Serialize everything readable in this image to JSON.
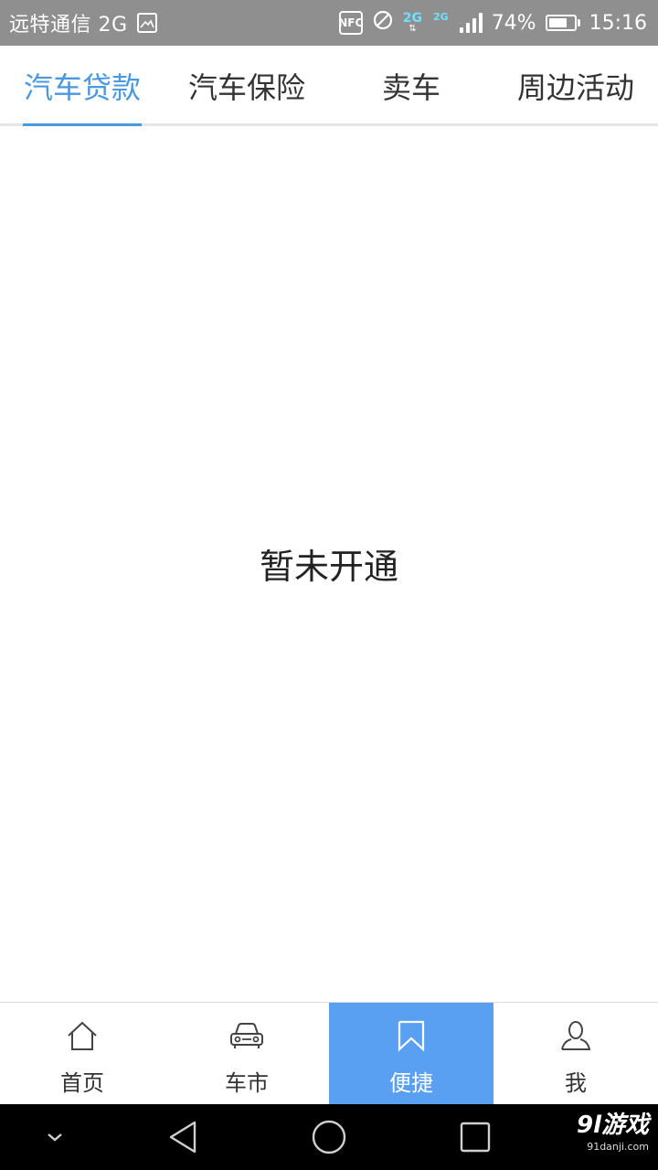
{
  "statusbar": {
    "carrier": "远特通信 2G",
    "nfc": "NFC",
    "network_primary": "2G",
    "network_secondary": "2G",
    "battery_percent_text": "74%",
    "battery_level": 0.74,
    "time": "15:16"
  },
  "tabs": [
    {
      "label": "汽车贷款",
      "active": true
    },
    {
      "label": "汽车保险",
      "active": false
    },
    {
      "label": "卖车",
      "active": false
    },
    {
      "label": "周边活动",
      "active": false
    }
  ],
  "content": {
    "empty_message": "暂未开通"
  },
  "bottomnav": [
    {
      "label": "首页",
      "icon": "home-icon",
      "active": false
    },
    {
      "label": "车市",
      "icon": "car-icon",
      "active": false
    },
    {
      "label": "便捷",
      "icon": "bookmark-icon",
      "active": true
    },
    {
      "label": "我",
      "icon": "user-icon",
      "active": false
    }
  ],
  "watermark": {
    "main": "9l游戏",
    "sub": "91danji.com"
  },
  "colors": {
    "accent": "#4a98df",
    "active_nav_bg": "#5aa0f2",
    "statusbar_bg": "#8f8f8f"
  }
}
